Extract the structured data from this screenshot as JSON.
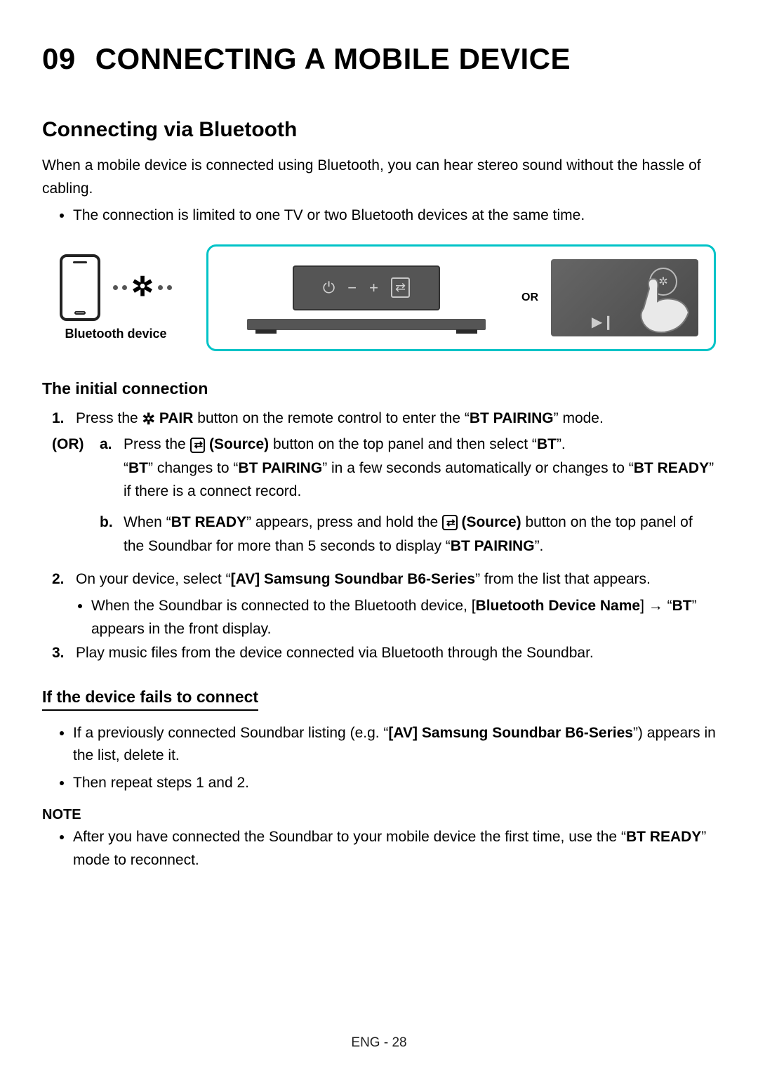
{
  "chapter": {
    "num": "09",
    "title": "CONNECTING A MOBILE DEVICE"
  },
  "section": "Connecting via Bluetooth",
  "intro": "When a mobile device is connected using Bluetooth, you can hear stereo sound without the hassle of cabling.",
  "intro_bullet": "The connection is limited to one TV or two Bluetooth devices at the same time.",
  "diagram": {
    "bt_device_label": "Bluetooth device",
    "or": "OR"
  },
  "subsec_initial": "The initial connection",
  "step1": {
    "num": "1.",
    "pre": "Press the ",
    "pair": " PAIR",
    "post": " button on the remote control to enter the “",
    "bt_pairing": "BT PAIRING",
    "tail": "” mode."
  },
  "or": "(OR)",
  "step_a": {
    "num": "a.",
    "pre": "Press the ",
    "source": " (Source)",
    "mid": " button on the top panel and then select “",
    "bt": "BT",
    "endq": "”.",
    "line2_pre": "“",
    "line2_bt": "BT",
    "line2_mid": "” changes to “",
    "line2_btp": "BT PAIRING",
    "line2_mid2": "” in a few seconds automatically or changes to “",
    "line2_btr": "BT READY",
    "line2_end": "” if there is a connect record."
  },
  "step_b": {
    "num": "b.",
    "pre": "When “",
    "btr": "BT READY",
    "mid": "” appears, press and hold the ",
    "source": " (Source)",
    "mid2": " button on the top panel of the Soundbar for more than 5 seconds to display “",
    "btp": "BT PAIRING",
    "end": "”."
  },
  "step2": {
    "num": "2.",
    "pre": "On your device, select “",
    "devname": "[AV] Samsung Soundbar B6-Series",
    "end": "” from the list that appears.",
    "bullet_pre": "When the Soundbar is connected to the Bluetooth device, [",
    "bullet_devname": "Bluetooth Device Name",
    "bullet_arrow": "] → “",
    "bullet_bt": "BT",
    "bullet_end": "” appears in the front display."
  },
  "step3": {
    "num": "3.",
    "text": "Play music files from the device connected via Bluetooth through the Soundbar."
  },
  "subsec_fail": "If the device fails to connect",
  "fail_b1_pre": "If a previously connected Soundbar listing (e.g. “",
  "fail_b1_dev": "[AV] Samsung Soundbar B6-Series",
  "fail_b1_end": "”) appears in the list, delete it.",
  "fail_b2": "Then repeat steps 1 and 2.",
  "note": "NOTE",
  "note_b1_pre": "After you have connected the Soundbar to your mobile device the first time, use the “",
  "note_b1_btr": "BT READY",
  "note_b1_end": "” mode to reconnect.",
  "footer": "ENG - 28"
}
